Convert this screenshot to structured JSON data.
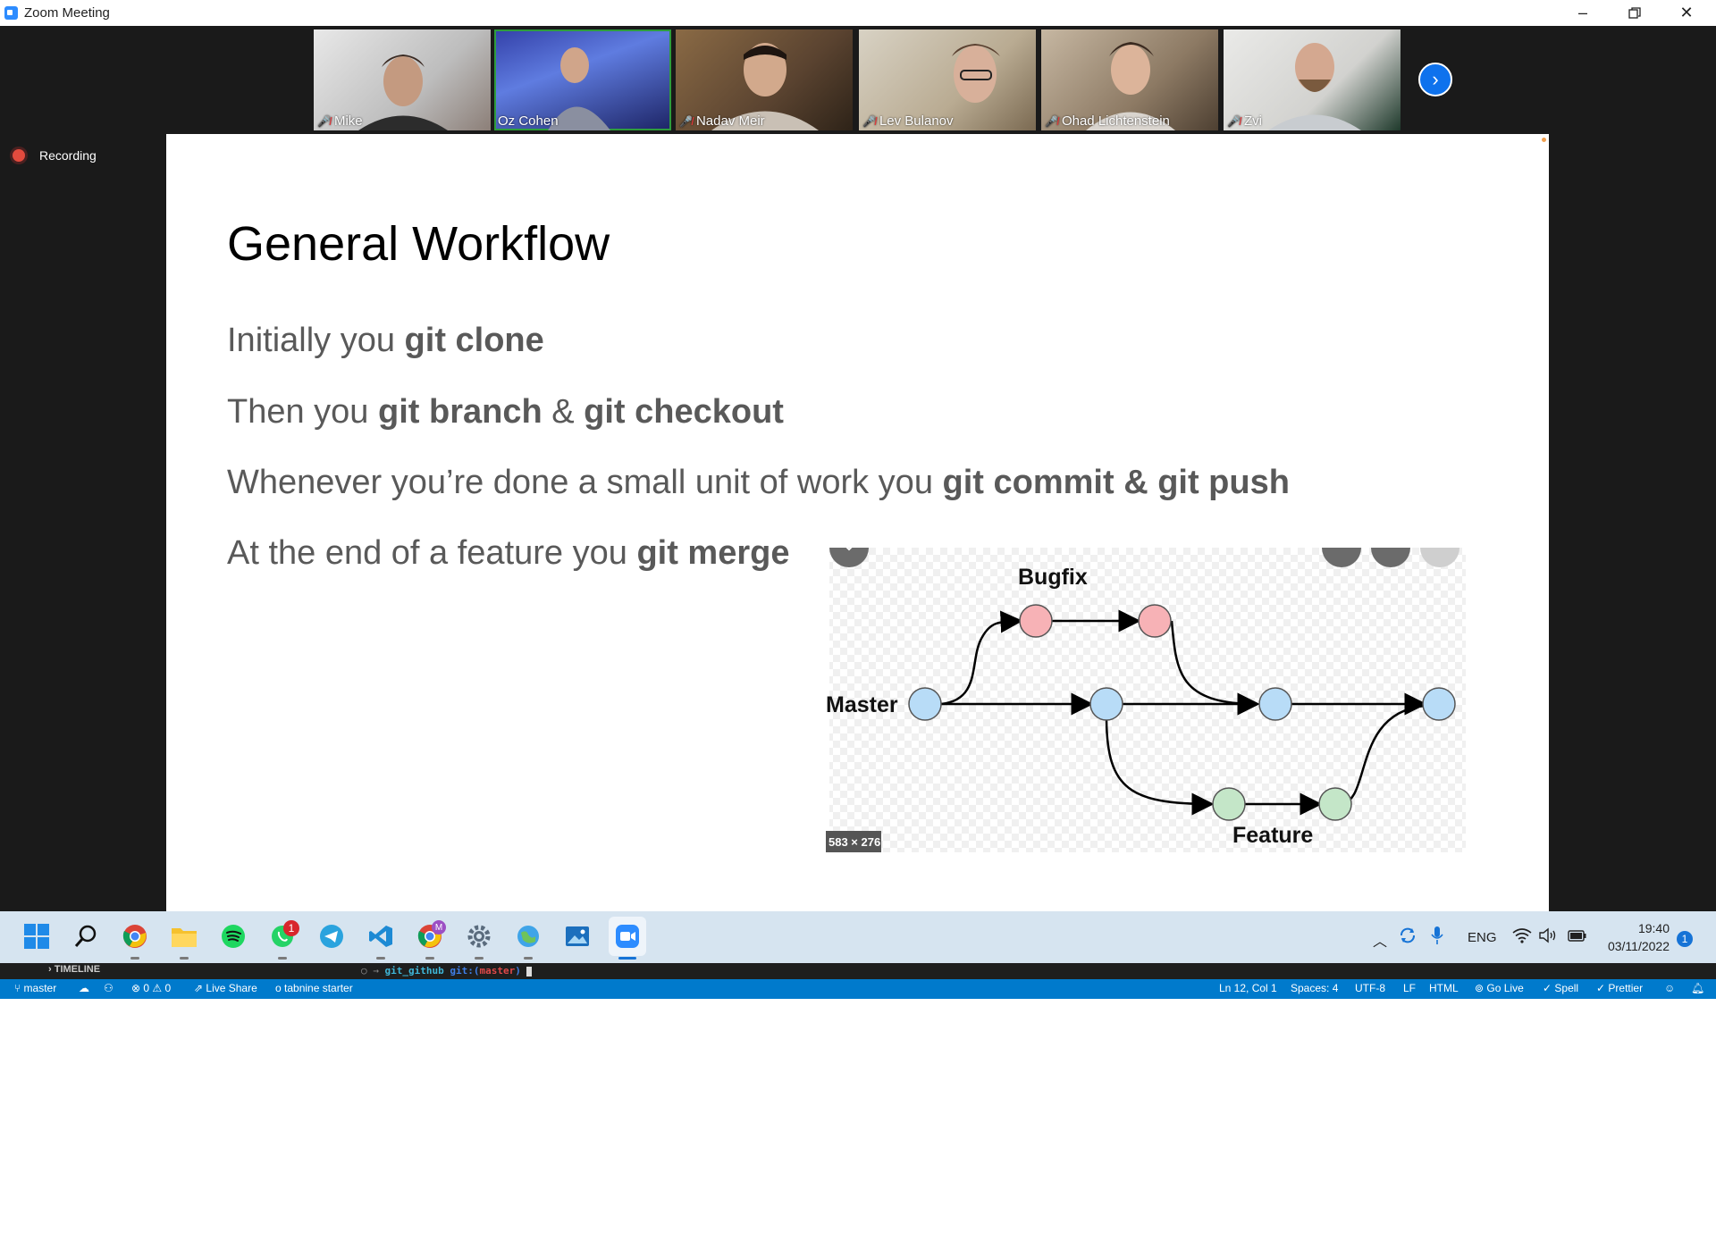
{
  "window": {
    "title": "Zoom Meeting",
    "controls": [
      "minimize-icon",
      "restore-icon",
      "close-icon"
    ]
  },
  "participants": [
    {
      "name": "Mike",
      "muted": true
    },
    {
      "name": "Oz Cohen",
      "muted": false,
      "active_speaker": true
    },
    {
      "name": "Nadav Meir",
      "muted": true
    },
    {
      "name": "Lev Bulanov",
      "muted": true
    },
    {
      "name": "Ohad Lichtenstein",
      "muted": true
    },
    {
      "name": "Zvi",
      "muted": true
    }
  ],
  "recording": {
    "label": "Recording"
  },
  "slide": {
    "title": "General Workflow",
    "bullets": [
      {
        "text": "Initially you ",
        "bold": "git clone"
      },
      {
        "text": "Then you ",
        "bold1": "git branch",
        "mid": " & ",
        "bold2": "git checkout"
      },
      {
        "text": "Whenever you’re done a small unit of work you ",
        "bold": "git commit & git push"
      },
      {
        "text": "At the end of a feature you ",
        "bold": "git merge"
      }
    ],
    "diagram": {
      "labels": {
        "bugfix": "Bugfix",
        "master": "Master",
        "feature": "Feature"
      },
      "image_size": "583 × 276",
      "colors": {
        "master": "#b8dcf7",
        "bugfix": "#f7b2b6",
        "feature": "#c4e6c8"
      }
    }
  },
  "taskbar": {
    "apps": [
      "windows-start-icon",
      "search-icon",
      "chrome-icon",
      "file-explorer-icon",
      "spotify-icon",
      "whatsapp-icon",
      "telegram-icon",
      "vscode-icon",
      "chrome-profile-icon",
      "settings-icon",
      "maps-icon",
      "photos-icon",
      "zoom-icon"
    ],
    "whatsapp_badge": "1",
    "chrome_profile_badge": "M",
    "language": "ENG",
    "time": "19:40",
    "date": "03/11/2022",
    "notification_count": "1"
  },
  "vscode": {
    "timeline_label": "TIMELINE",
    "terminal_prompt": "○ → ",
    "terminal_dir": "git_github",
    "terminal_git": "git:(",
    "terminal_branch": "master",
    "terminal_close": ")",
    "status": {
      "branch": "master",
      "problems": "⊗ 0 ⚠ 0",
      "live_share": "Live Share",
      "tabnine": "tabnine starter",
      "position": "Ln 12, Col 1",
      "spaces": "Spaces: 4",
      "encoding": "UTF-8",
      "eol": "LF",
      "language": "HTML",
      "go_live": "Go Live",
      "spell": "Spell",
      "prettier": "Prettier"
    }
  }
}
